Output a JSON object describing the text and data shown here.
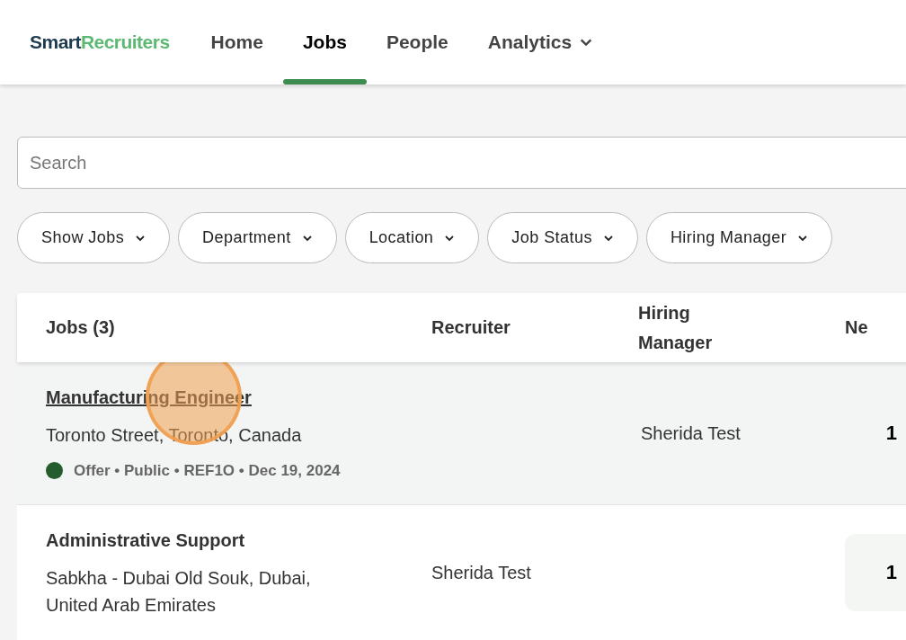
{
  "brand": {
    "part1": "Smart",
    "part2": "Recruiters"
  },
  "nav": [
    {
      "label": "Home",
      "selected": false,
      "dropdown": false
    },
    {
      "label": "Jobs",
      "selected": true,
      "dropdown": false
    },
    {
      "label": "People",
      "selected": false,
      "dropdown": false
    },
    {
      "label": "Analytics",
      "selected": false,
      "dropdown": true
    }
  ],
  "search": {
    "placeholder": "Search"
  },
  "filters": [
    "Show Jobs",
    "Department",
    "Location",
    "Job Status",
    "Hiring Manager"
  ],
  "table": {
    "columns": [
      "Jobs (3)",
      "Recruiter",
      "Hiring Manager",
      "Ne"
    ],
    "rows": [
      {
        "title": "Manufacturing Engineer",
        "location": "Toronto Street, Toronto, Canada",
        "status": "Offer • Public • REF1O • Dec 19, 2024",
        "color": "#245c2e",
        "recruiter": "",
        "hiring_manager": "Sherida Test",
        "new": "1",
        "highlighted": true
      },
      {
        "title": "Administrative Support",
        "location": "Sabkha - Dubai Old Souk, Dubai, United Arab Emirates",
        "recruiter": "Sherida Test",
        "hiring_manager": "",
        "new": "1",
        "highlighted": false
      }
    ]
  }
}
